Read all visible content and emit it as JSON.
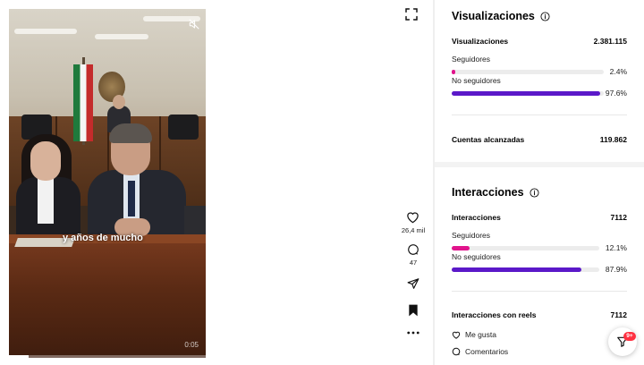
{
  "video": {
    "caption": "y años de mucho",
    "timecode": "0:05",
    "progress": 0.1
  },
  "actions": {
    "likes": "26,4 mil",
    "comments": "47"
  },
  "views_section": {
    "title": "Visualizaciones",
    "total_label": "Visualizaciones",
    "total_value": "2.381.115",
    "followers_label": "Seguidores",
    "followers_pct": "2.4%",
    "followers_value": 0.024,
    "non_followers_label": "No seguidores",
    "non_followers_pct": "97.6%",
    "non_followers_value": 0.976,
    "reach_label": "Cuentas alcanzadas",
    "reach_value": "119.862"
  },
  "interactions_section": {
    "title": "Interacciones",
    "total_label": "Interacciones",
    "total_value": "7112",
    "followers_label": "Seguidores",
    "followers_pct": "12.1%",
    "followers_value": 0.121,
    "non_followers_label": "No seguidores",
    "non_followers_pct": "87.9%",
    "non_followers_value": 0.879,
    "reels_label": "Interacciones con reels",
    "reels_value": "7112",
    "likes_label": "Me gusta",
    "comments_label": "Comentarios"
  },
  "fab": {
    "badge": "9+"
  },
  "colors": {
    "followers_bar": "#e1148c",
    "non_followers_bar": "#5b19c9",
    "badge": "#ff3040"
  },
  "icons": [
    "mute-icon",
    "fullscreen-icon",
    "heart-icon",
    "comment-icon",
    "share-icon",
    "save-icon",
    "more-icon",
    "info-icon",
    "filter-icon"
  ]
}
